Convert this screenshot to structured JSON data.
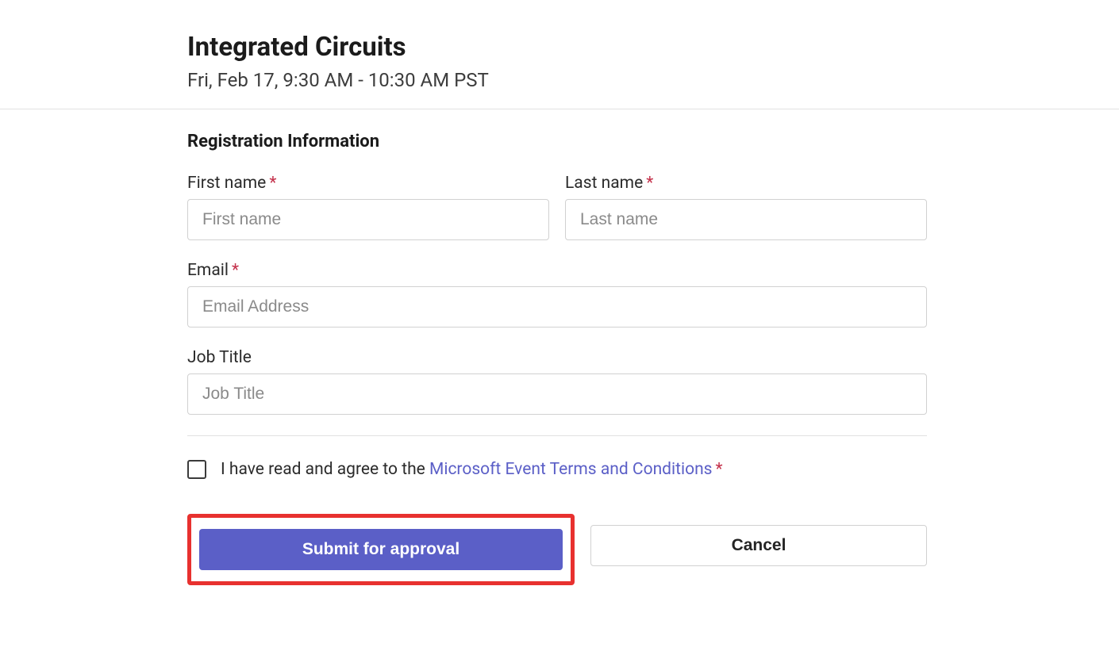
{
  "header": {
    "title": "Integrated Circuits",
    "datetime": "Fri, Feb 17, 9:30 AM - 10:30 AM PST"
  },
  "form": {
    "section_heading": "Registration Information",
    "first_name": {
      "label": "First name",
      "placeholder": "First name",
      "required": true
    },
    "last_name": {
      "label": "Last name",
      "placeholder": "Last name",
      "required": true
    },
    "email": {
      "label": "Email",
      "placeholder": "Email Address",
      "required": true
    },
    "job_title": {
      "label": "Job Title",
      "placeholder": "Job Title",
      "required": false
    },
    "consent": {
      "prefix_text": "I have read and agree to the ",
      "link_text": "Microsoft Event Terms and Conditions",
      "required_marker": "*"
    },
    "buttons": {
      "submit": "Submit for approval",
      "cancel": "Cancel"
    },
    "required_marker": "*"
  }
}
